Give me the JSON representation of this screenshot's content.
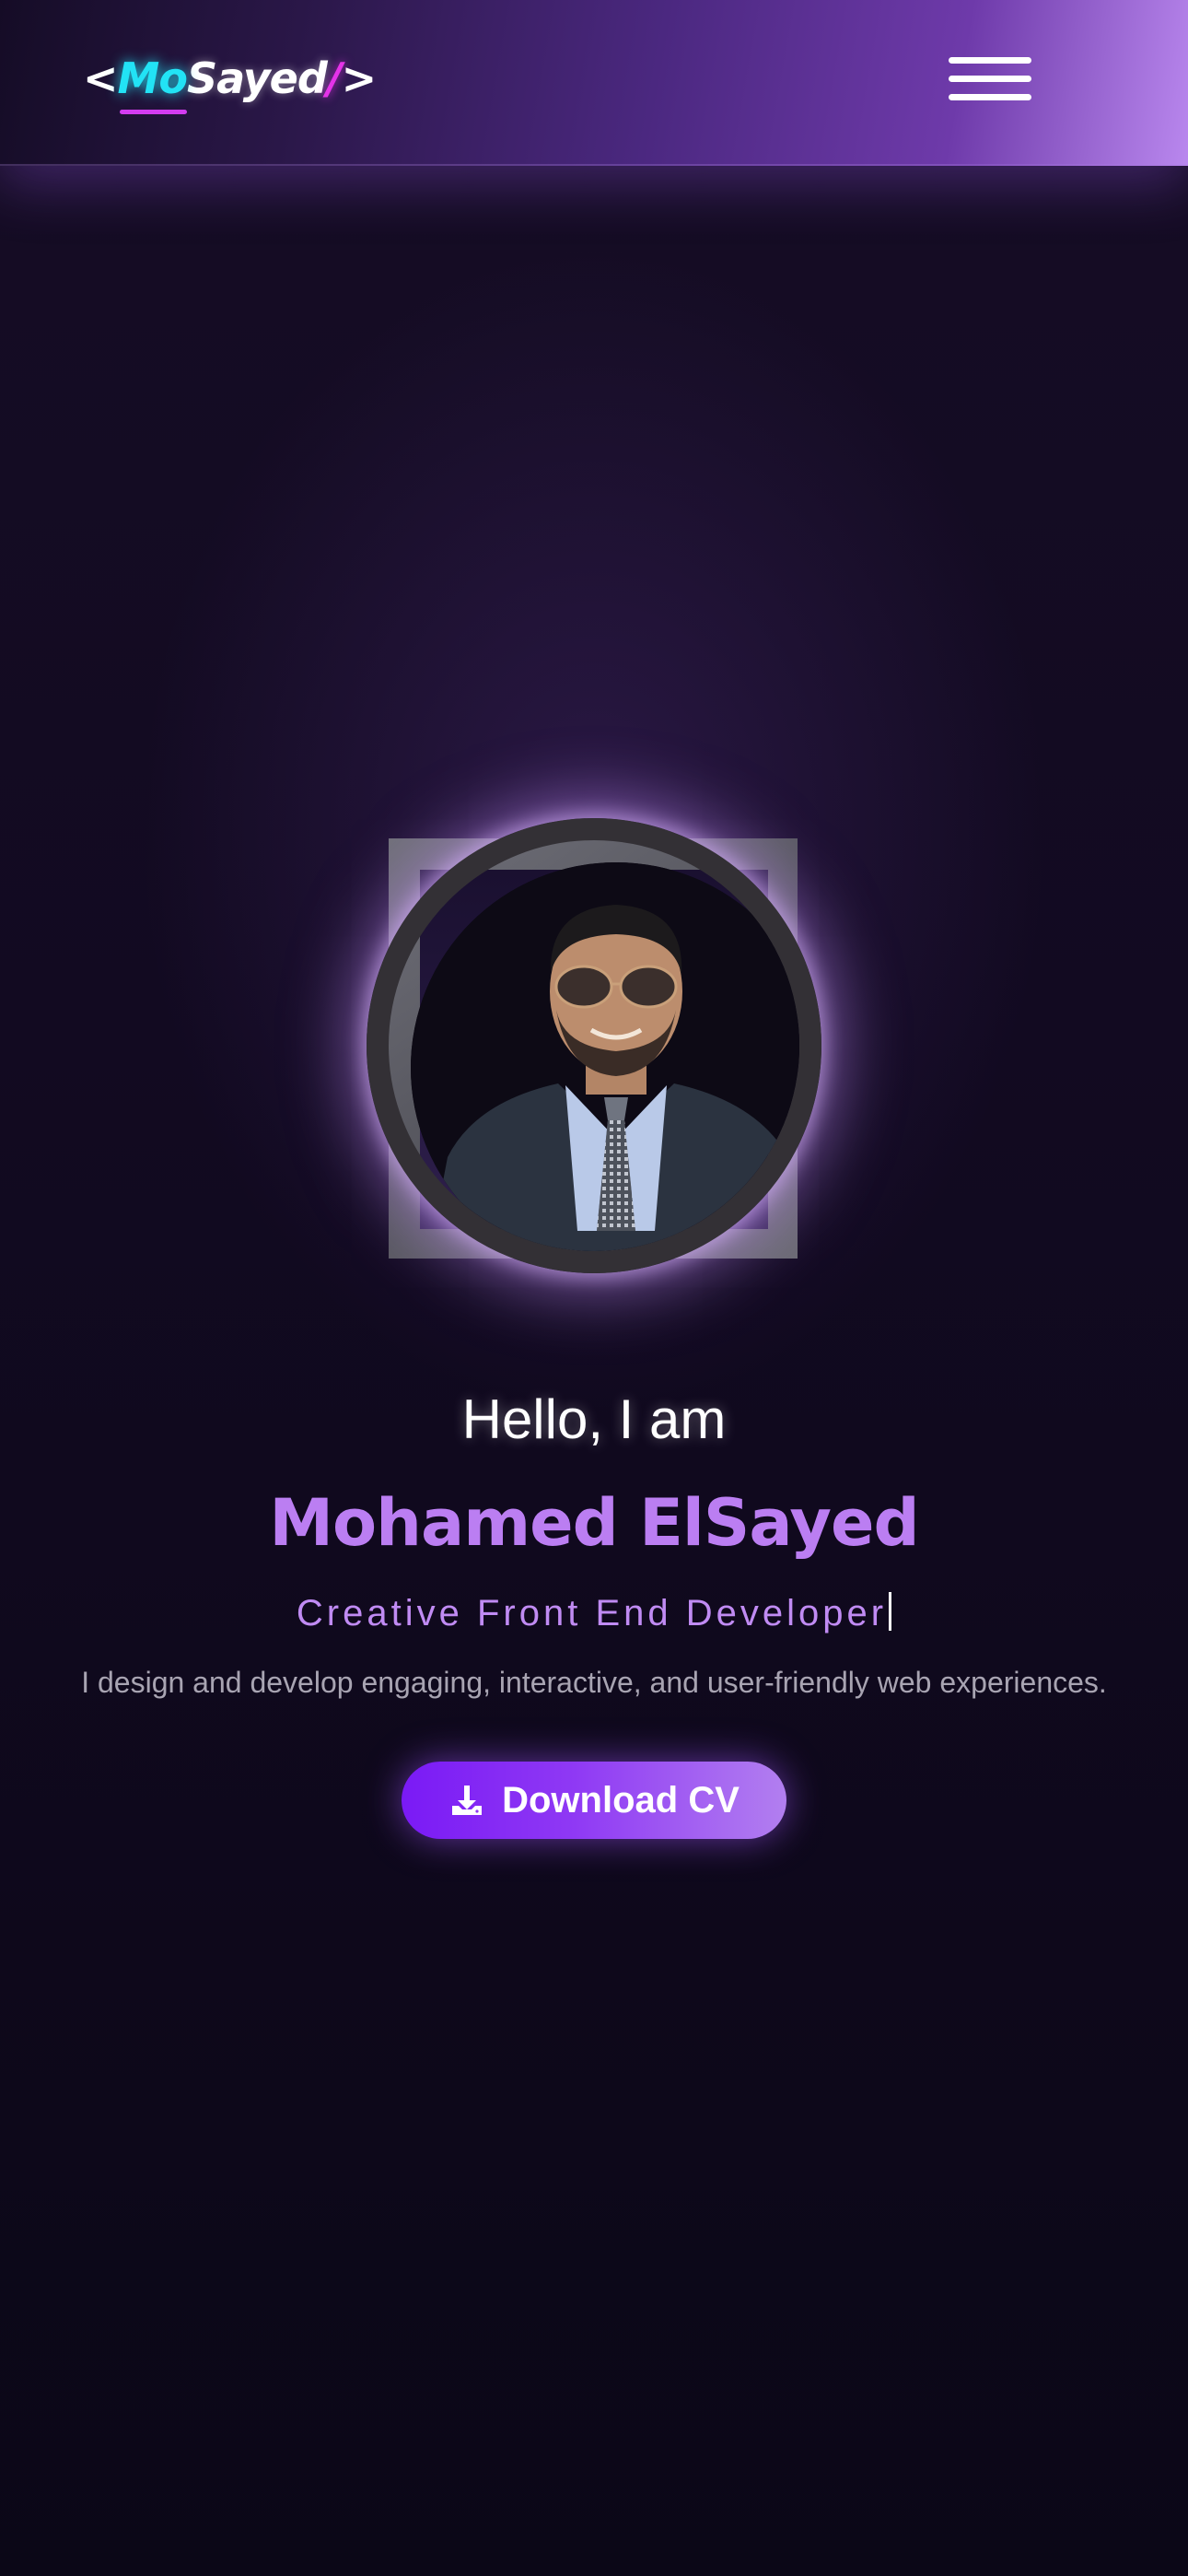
{
  "header": {
    "logo": {
      "open_bracket": "<",
      "mo": "Mo",
      "sayed": "Sayed",
      "slash": "/",
      "close_bracket": ">"
    },
    "menu_icon": "hamburger-menu-icon"
  },
  "hero": {
    "greeting": "Hello, I am",
    "name": "Mohamed ElSayed",
    "role": "Creative Front End Developer",
    "description": "I design and develop engaging, interactive, and user-friendly web experiences.",
    "cv_button": {
      "label": "Download CV",
      "icon": "download-icon"
    }
  },
  "colors": {
    "background": "#0d0818",
    "accent_purple": "#bb7ef2",
    "logo_cyan": "#22e3f5",
    "logo_magenta": "#e433e8",
    "button_start": "#7a1af5",
    "button_end": "#b27ff0"
  }
}
